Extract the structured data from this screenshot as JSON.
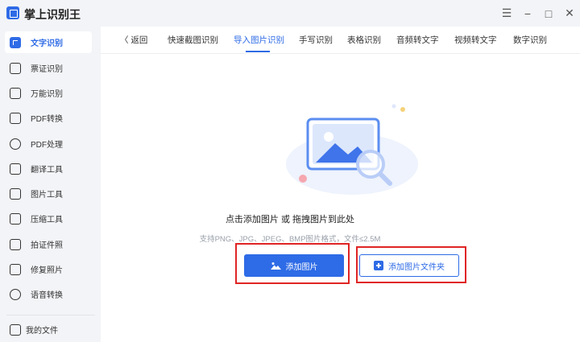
{
  "app": {
    "title": "掌上识别王"
  },
  "window_controls": {
    "menu": "☰",
    "minimize": "−",
    "maximize": "□",
    "close": "✕"
  },
  "sidebar": {
    "items": [
      {
        "label": "文字识别",
        "icon": "text-recognition-icon",
        "active": true
      },
      {
        "label": "票证识别",
        "icon": "ticket-icon"
      },
      {
        "label": "万能识别",
        "icon": "universal-recognition-icon"
      },
      {
        "label": "PDF转换",
        "icon": "pdf-convert-icon"
      },
      {
        "label": "PDF处理",
        "icon": "pdf-process-icon"
      },
      {
        "label": "翻译工具",
        "icon": "translate-icon"
      },
      {
        "label": "图片工具",
        "icon": "image-tools-icon"
      },
      {
        "label": "压缩工具",
        "icon": "compress-icon"
      },
      {
        "label": "拍证件照",
        "icon": "id-photo-icon"
      },
      {
        "label": "修复照片",
        "icon": "photo-repair-icon"
      },
      {
        "label": "语音转换",
        "icon": "voice-convert-icon"
      }
    ],
    "my_files": {
      "label": "我的文件",
      "icon": "my-files-icon"
    }
  },
  "tabs": {
    "back_label": "〈 返回",
    "items": [
      {
        "label": "快速截图识别"
      },
      {
        "label": "导入图片识别",
        "active": true
      },
      {
        "label": "手写识别"
      },
      {
        "label": "表格识别"
      },
      {
        "label": "音频转文字"
      },
      {
        "label": "视频转文字"
      },
      {
        "label": "数字识别"
      }
    ]
  },
  "main": {
    "hint": "点击添加图片 或 拖拽图片到此处",
    "support": "支持PNG、JPG、JPEG、BMP图片格式，文件≤2.5M",
    "add_image_label": "添加图片",
    "add_folder_label": "添加图片文件夹"
  },
  "colors": {
    "accent": "#2e6be6",
    "sidebar_bg": "#f3f4f7",
    "highlight": "#e02424"
  }
}
